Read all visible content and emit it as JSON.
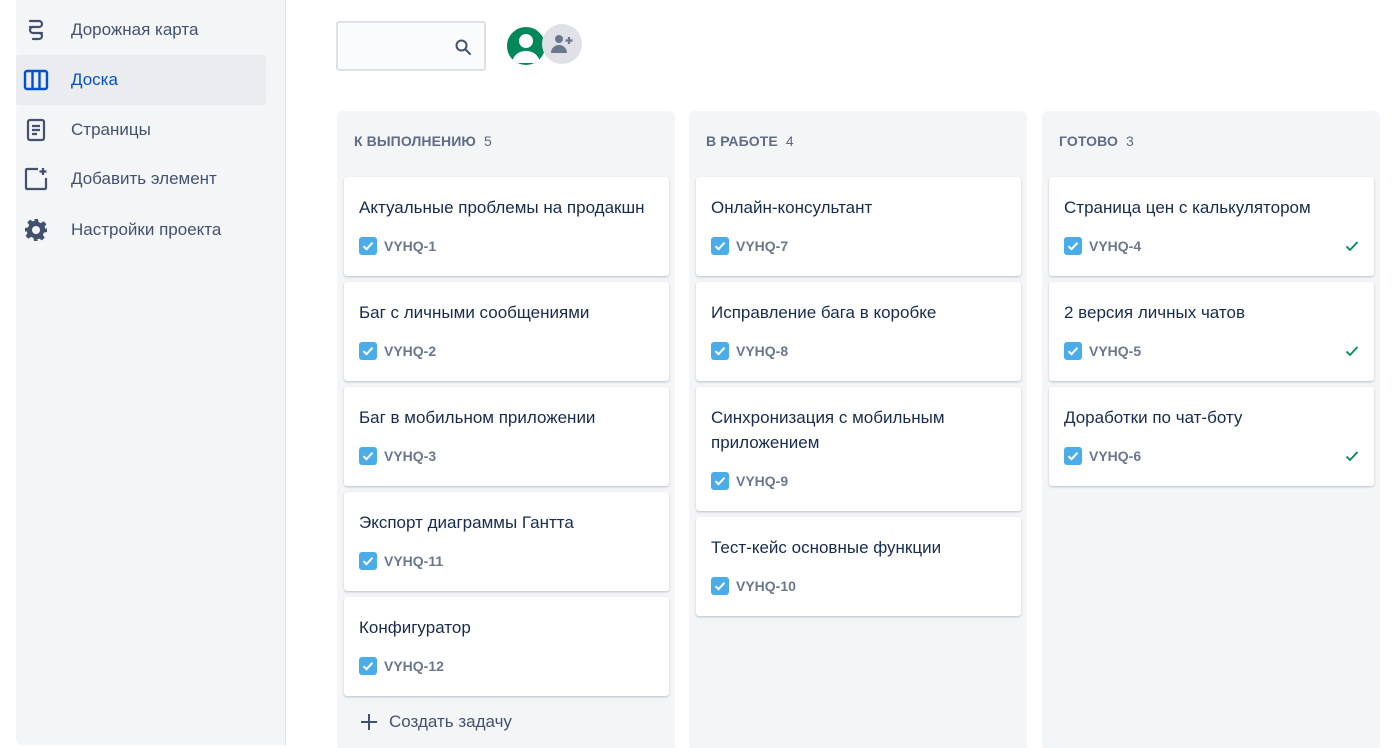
{
  "sidebar": {
    "items": [
      {
        "label": "Дорожная карта",
        "icon": "roadmap-icon",
        "active": false
      },
      {
        "label": "Доска",
        "icon": "board-icon",
        "active": true
      },
      {
        "label": "Страницы",
        "icon": "pages-icon",
        "active": false
      },
      {
        "label": "Добавить элемент",
        "icon": "add-item-icon",
        "active": false
      },
      {
        "label": "Настройки проекта",
        "icon": "gear-icon",
        "active": false
      }
    ]
  },
  "search": {
    "value": "",
    "placeholder": ""
  },
  "colors": {
    "accent": "#0052cc",
    "avatar": "#00875a",
    "issue_check": "#4bade8",
    "done": "#00875a"
  },
  "board": {
    "create_task_label": "Создать задачу",
    "columns": [
      {
        "title": "К ВЫПОЛНЕНИЮ",
        "count": "5",
        "cards": [
          {
            "title": "Актуальные проблемы на продакшн",
            "key": "VYHQ-1"
          },
          {
            "title": "Баг с личными сообщениями",
            "key": "VYHQ-2"
          },
          {
            "title": "Баг в мобильном приложении",
            "key": "VYHQ-3"
          },
          {
            "title": "Экспорт диаграммы Гантта",
            "key": "VYHQ-11"
          },
          {
            "title": "Конфигуратор",
            "key": "VYHQ-12"
          }
        ]
      },
      {
        "title": "В РАБОТЕ",
        "count": "4",
        "cards": [
          {
            "title": "Онлайн-консультант",
            "key": "VYHQ-7"
          },
          {
            "title": "Исправление бага в коробке",
            "key": "VYHQ-8"
          },
          {
            "title": "Синхронизация с мобильным приложением",
            "key": "VYHQ-9"
          },
          {
            "title": "Тест-кейс основные функции",
            "key": "VYHQ-10"
          }
        ]
      },
      {
        "title": "ГОТОВО",
        "count": "3",
        "cards": [
          {
            "title": "Страница цен с калькулятором",
            "key": "VYHQ-4",
            "done": true
          },
          {
            "title": "2 версия личных чатов",
            "key": "VYHQ-5",
            "done": true
          },
          {
            "title": "Доработки по чат-боту",
            "key": "VYHQ-6",
            "done": true
          }
        ]
      }
    ]
  }
}
